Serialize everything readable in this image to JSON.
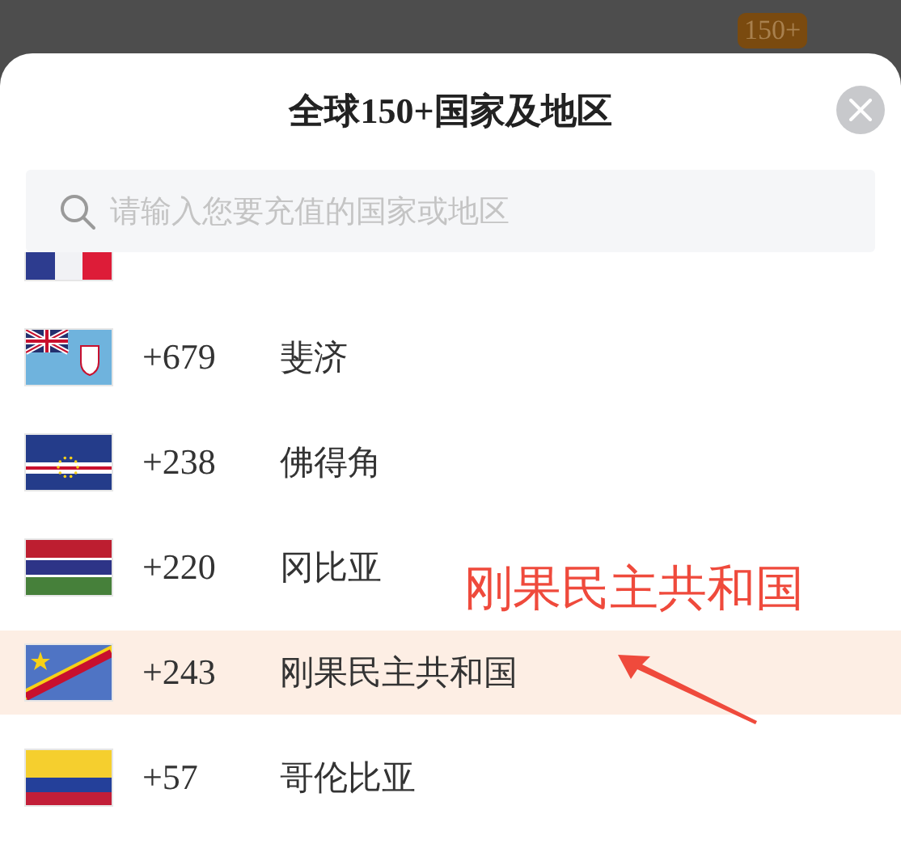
{
  "background": {
    "badge": "150+"
  },
  "sheet": {
    "title": "全球150+国家及地区",
    "search": {
      "placeholder": "请输入您要充值的国家或地区"
    }
  },
  "countries": [
    {
      "kind": "france",
      "selected": false
    },
    {
      "kind": "fiji",
      "code": "+679",
      "name": "斐济",
      "selected": false
    },
    {
      "kind": "capeverde",
      "code": "+238",
      "name": "佛得角",
      "selected": false
    },
    {
      "kind": "gambia",
      "code": "+220",
      "name": "冈比亚",
      "selected": false
    },
    {
      "kind": "congo",
      "code": "+243",
      "name": "刚果民主共和国",
      "selected": true
    },
    {
      "kind": "colombia",
      "code": "+57",
      "name": "哥伦比亚",
      "selected": false
    }
  ],
  "annotation": {
    "text": "刚果民主共和国"
  }
}
